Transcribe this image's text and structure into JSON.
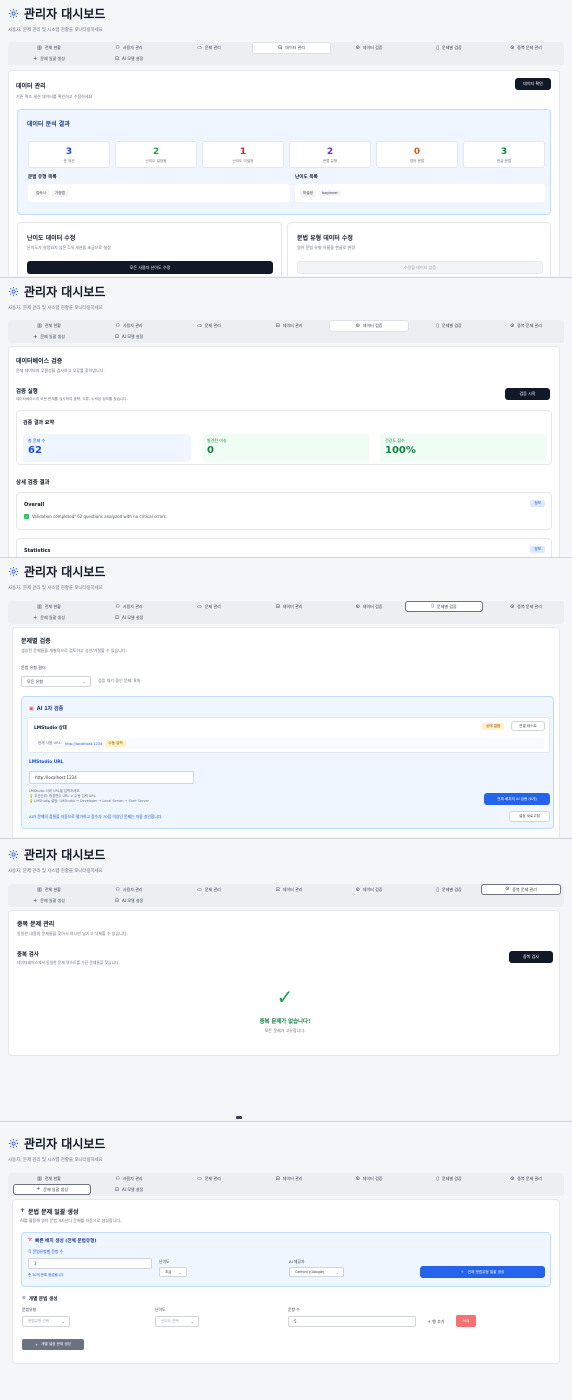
{
  "header": {
    "title": "관리자 대시보드",
    "subtitle": "사용자, 문제 관리 및 시스템 현황을 모니터링하세요"
  },
  "tabs": [
    {
      "label": "전체 현황",
      "icon": "bar-chart-icon"
    },
    {
      "label": "사용자 관리",
      "icon": "users-icon"
    },
    {
      "label": "문제 관리",
      "icon": "book-icon"
    },
    {
      "label": "데이터 관리",
      "icon": "database-icon"
    },
    {
      "label": "데이터 검증",
      "icon": "check-circle-icon"
    },
    {
      "label": "문제별 검증",
      "icon": "book-open-icon"
    },
    {
      "label": "중복 문제 관리",
      "icon": "copy-icon"
    },
    {
      "label": "문제 일괄 생성",
      "icon": "plus-icon"
    },
    {
      "label": "AI 모델 설정",
      "icon": "chip-icon"
    }
  ],
  "data_mgmt": {
    "title": "데이터 관리",
    "subtitle": "기존 퀴즈 세션 데이터를 확인하고 수정하세요",
    "check_button": "데이터 확인",
    "analysis_title": "데이터 분석 결과",
    "stats": [
      {
        "value": "3",
        "label": "총 세션",
        "color": "#1d4ed8"
      },
      {
        "value": "2",
        "label": "난이도 설정됨",
        "color": "#16a34a"
      },
      {
        "value": "1",
        "label": "난이도 미설정",
        "color": "#dc2626"
      },
      {
        "value": "2",
        "label": "문법 유형",
        "color": "#7e22ce"
      },
      {
        "value": "0",
        "label": "영어 문법",
        "color": "#ea580c"
      },
      {
        "value": "3",
        "label": "한글 문법",
        "color": "#15803d"
      }
    ],
    "grammar_list_title": "문법 유형 목록",
    "grammar_chips": [
      "접속사",
      "가정법"
    ],
    "difficulty_list_title": "난이도 목록",
    "difficulty_chips": [
      "미설정",
      "beginner"
    ],
    "difficulty_fix_title": "난이도 데이터 수정",
    "difficulty_fix_desc": "난이도가 설정되지 않은 1개 세션을 초급으로 설정",
    "difficulty_fix_button": "모든 사용자 난이도 수정",
    "grammar_fix_title": "문법 유형 데이터 수정",
    "grammar_fix_desc": "영어 문법 유형 이름을 한글로 변경",
    "grammar_fix_button": "수정할 데이터 없음"
  },
  "db_validation": {
    "title": "데이터베이스 검증",
    "subtitle": "문제 데이터의 무결성을 검사하고 오류를 찾아냅니다.",
    "run_title": "검증 실행",
    "run_desc": "데이터베이스의 모든 문제를 검사하여 중복, 오류, 누락된 정보를 찾습니다.",
    "run_button": "검증 시작",
    "summary_title": "검증 결과 요약",
    "summary": [
      {
        "label": "총 문제 수",
        "value": "62",
        "bg": "#eff6ff",
        "color": "#1d4ed8"
      },
      {
        "label": "발견된 이슈",
        "value": "0",
        "bg": "#f0fdf4",
        "color": "#15803d"
      },
      {
        "label": "건강도 점수",
        "value": "100%",
        "bg": "#f0fdf4",
        "color": "#15803d"
      }
    ],
    "detail_title": "상세 검증 결과",
    "overall_title": "Overall",
    "overall_badge": "정보",
    "overall_msg": "Validation completed! 62 questions analyzed with no critical errors.",
    "statistics_title": "Statistics",
    "statistics_badge": "정보"
  },
  "per_question": {
    "title": "문제별 검증",
    "subtitle": "생성된 문제들을 개별적으로 검토하고 승인/거절할 수 있습니다.",
    "filter_label": "문법 유형 필터",
    "filter_value": "모든 유형",
    "pending_text": "검증 대기 중인 문제: 8개",
    "ai_title": "AI 1차 검증",
    "lm_status": "LMStudio 상태",
    "status_badge": "상태 없음",
    "test_button": "연결 테스트",
    "current_url_label": "현재 사용 URL:",
    "current_url": "http://localhost:1234",
    "manual_badge": "수동 입력",
    "url_label": "LMStudio URL",
    "url_value": "http://localhost:1234",
    "hint1": "LMStudio 서버 URL을 입력하세요",
    "hint2": "💡 우선순위: 환경변수 URL > 수동 입력 URL",
    "hint3": "💡 LMStudio 설정: LMStudio → Developer → Local Server → Start Server",
    "batch_button": "전체 배치의 AI 검증 (8개)",
    "ai_desc": "AI가 문제의 품질을 자동으로 평가하고 점수가 70점 이상인 문제는 자동 승인합니다.",
    "reset_button": "설정 새로고침"
  },
  "duplicates": {
    "title": "중복 문제 관리",
    "subtitle": "동일한 내용의 문제들을 찾아서 하나만 남기고 삭제할 수 있습니다.",
    "check_title": "중복 검사",
    "check_desc": "데이터베이스에서 동일한 문제 텍스트를 가진 문제들을 찾습니다.",
    "check_button": "중복 검사",
    "ok_mark": "✓",
    "ok_title": "중복 문제가 없습니다!",
    "ok_desc": "모든 문제가 고유합니다."
  },
  "bulk": {
    "title": "문법 문제 일괄 생성",
    "subtitle": "AI를 활용해 영어 문법 4지선다 문제를 자동으로 생성합니다.",
    "quick_title": "빠른 배치 생성 (전체 문법유형)",
    "count_label": "각 문법유형별 문항 수",
    "count_value": "3",
    "count_hint": "총 30개 문제 생성됩니다",
    "difficulty_label": "난이도",
    "difficulty_value": "초급",
    "provider_label": "AI 제공자",
    "provider_value": "Gemini (Google)",
    "generate_button": "전체 문법유형 일괄 생성",
    "individual_title": "개별 문법 생성",
    "grammar_label": "문법유형",
    "grammar_placeholder": "문법유형 선택",
    "ind_difficulty_label": "난이도",
    "ind_difficulty_placeholder": "난이도 선택",
    "ind_count_label": "문항 수",
    "ind_count_value": "5",
    "add_row_button": "+ 행 추가",
    "delete_button": "삭제",
    "start_button": "개별 설정 문제 생성"
  }
}
